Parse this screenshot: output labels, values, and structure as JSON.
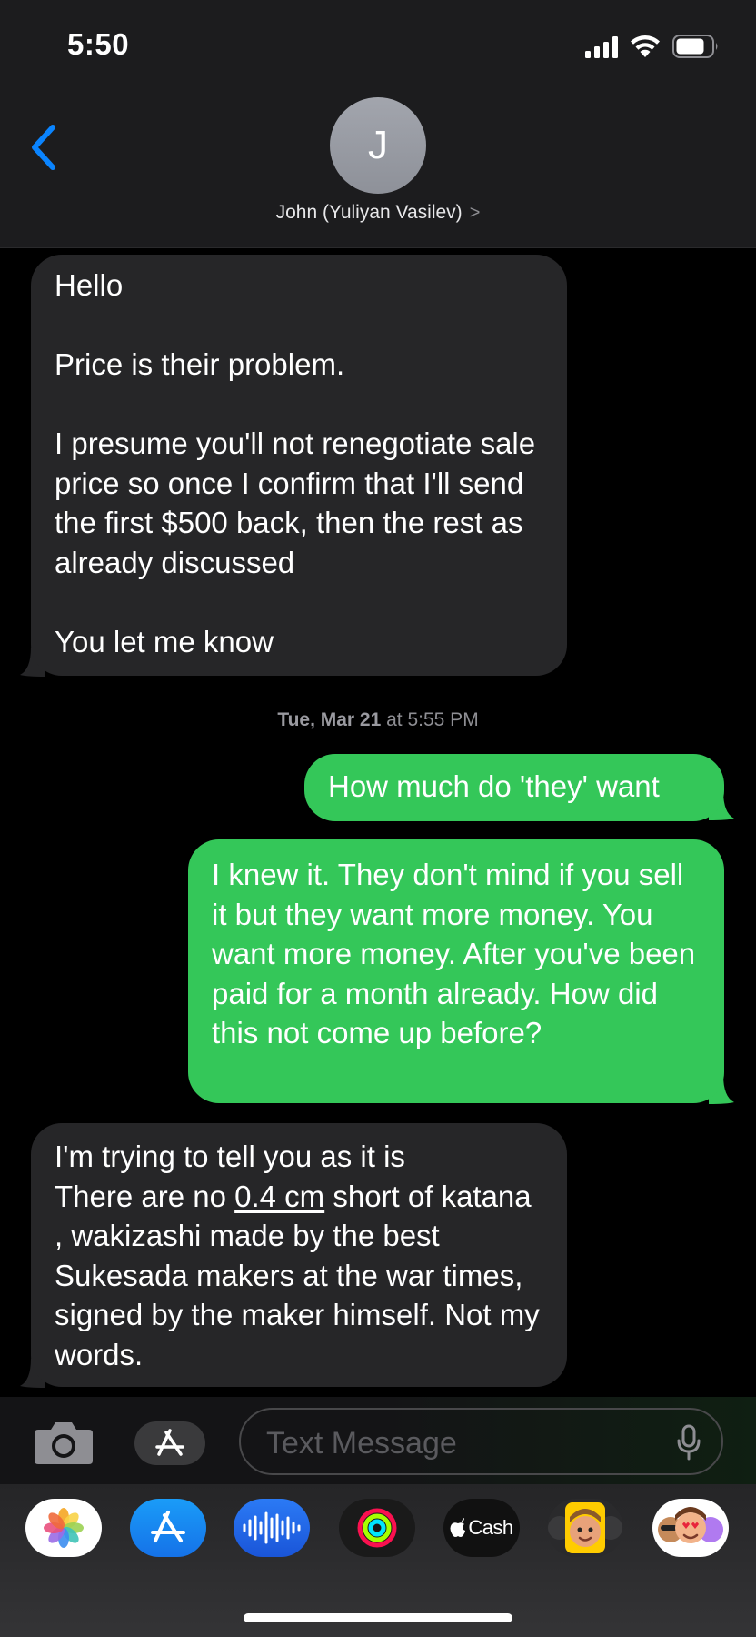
{
  "status_bar": {
    "time": "5:50"
  },
  "header": {
    "avatar_initial": "J",
    "contact_name": "John (Yuliyan Vasilev)",
    "contact_chevron": ">"
  },
  "conversation": {
    "msg1": "Hello\n\nPrice is their problem.\n\nI presume you'll not renegotiate sale price so once I confirm that I'll send the first $500 back, then the rest as already discussed\n\nYou let me know",
    "timestamp_day": "Tue, Mar 21",
    "timestamp_time": " at 5:55 PM",
    "msg2": "How much do 'they' want",
    "msg3": "I knew it. They don't mind if you sell it but they want more money. You want more money. After you've been paid for a month already. How did this not come up before?",
    "msg4": {
      "before": "I'm trying to tell you as it is\nThere are no ",
      "link": "0.4 cm",
      "after": " short of katana , wakizashi made by the best Sukesada makers at the war times, signed by the maker himself. Not my words."
    }
  },
  "input": {
    "placeholder": "Text Message"
  },
  "drawer": {
    "apps": [
      "photos-icon",
      "app-store-icon",
      "audio-message-icon",
      "activity-icon",
      "apple-cash-icon",
      "memoji-icon",
      "memoji-stickers-icon"
    ],
    "cash_label": "Cash"
  },
  "colors": {
    "outgoing": "#34c759",
    "incoming": "#262628",
    "accent": "#0a84ff"
  }
}
